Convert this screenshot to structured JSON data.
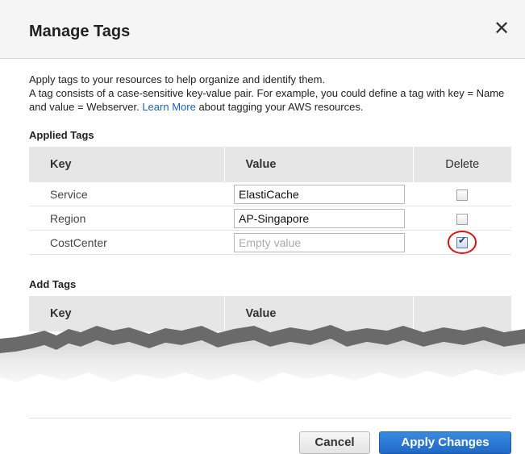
{
  "dialog": {
    "title": "Manage Tags",
    "close_icon": "close-icon"
  },
  "intro": {
    "line1": "Apply tags to your resources to help organize and identify them.",
    "line2_before_link": "A tag consists of a case-sensitive key-value pair. For example, you could define a tag with key = Name and value = Webserver.",
    "link": "Learn More",
    "line2_after_link": "about tagging your AWS resources."
  },
  "applied_tags": {
    "label": "Applied Tags",
    "columns": {
      "key": "Key",
      "value": "Value",
      "delete": "Delete"
    },
    "rows": [
      {
        "key": "Service",
        "value": "ElastiCache",
        "placeholder": "",
        "delete_checked": false
      },
      {
        "key": "Region",
        "value": "AP-Singapore",
        "placeholder": "",
        "delete_checked": false
      },
      {
        "key": "CostCenter",
        "value": "",
        "placeholder": "Empty value",
        "delete_checked": true
      }
    ]
  },
  "add_tags": {
    "label": "Add Tags",
    "columns": {
      "key": "Key",
      "value": "Value",
      "extra": ""
    }
  },
  "footer": {
    "cancel_label": "Cancel",
    "apply_label": "Apply Changes"
  },
  "colors": {
    "link": "#1a63b8",
    "primary_button": "#1e69c6",
    "highlight": "#e01010"
  }
}
